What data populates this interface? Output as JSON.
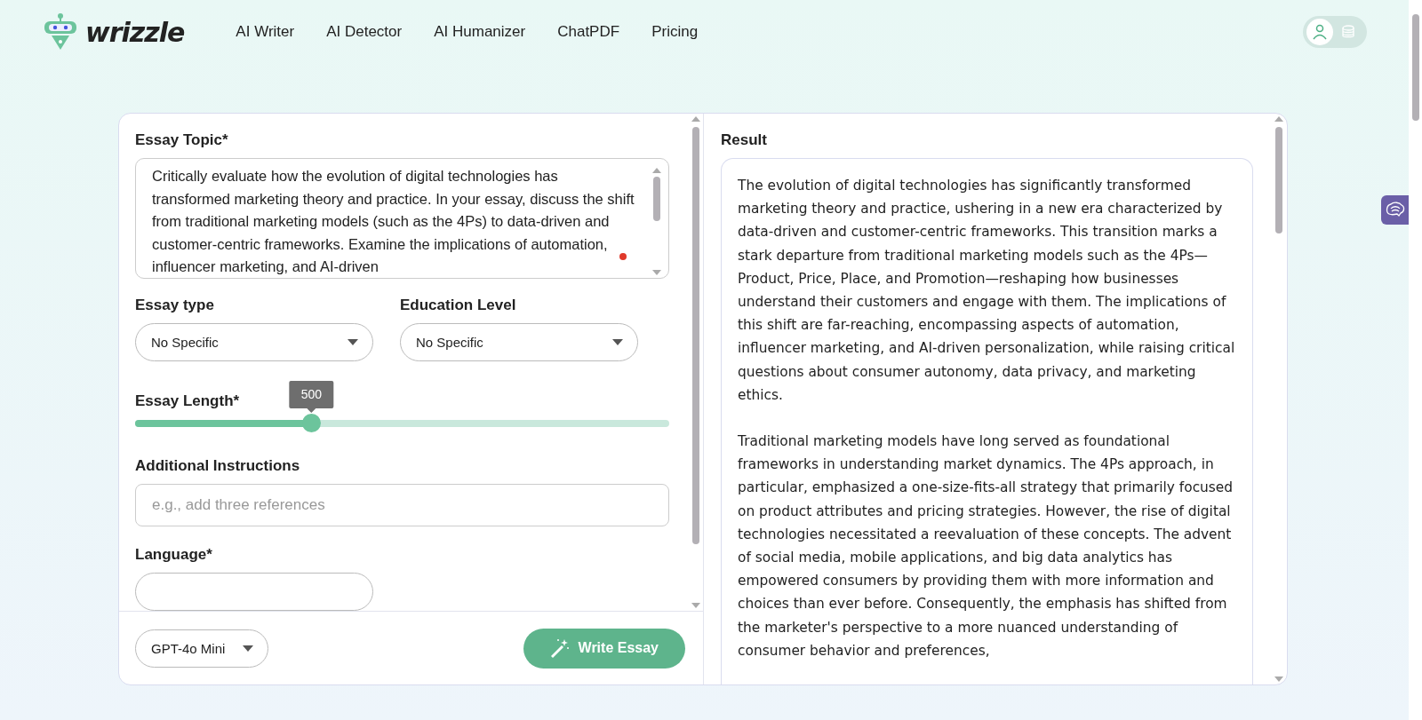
{
  "header": {
    "logo": "wrizzle",
    "nav": [
      "AI Writer",
      "AI Detector",
      "AI Humanizer",
      "ChatPDF",
      "Pricing"
    ],
    "account_toggle": [
      {
        "kind": "user",
        "selected": true
      },
      {
        "kind": "coins",
        "selected": false
      }
    ]
  },
  "form": {
    "topic": {
      "label": "Essay Topic*",
      "value": "Critically evaluate how the evolution of digital technologies has transformed marketing theory and practice. In your essay, discuss the shift from traditional marketing models (such as the 4Ps) to data-driven and customer-centric frameworks. Examine the implications of automation, influencer marketing, and AI-driven"
    },
    "essay_type": {
      "label": "Essay type",
      "value": "No Specific"
    },
    "education_level": {
      "label": "Education Level",
      "value": "No Specific"
    },
    "length": {
      "label": "Essay Length*",
      "value": "500",
      "level": 0.33
    },
    "instructions": {
      "label": "Additional Instructions",
      "placeholder": "e.g., add three references"
    },
    "language": {
      "label": "Language*"
    },
    "model": "GPT-4o Mini",
    "submit": "Write Essay"
  },
  "result": {
    "label": "Result",
    "paragraphs": [
      "The evolution of digital technologies has significantly transformed marketing theory and practice, ushering in a new era characterized by data-driven and customer-centric frameworks. This transition marks a stark departure from traditional marketing models such as the 4Ps—Product, Price, Place, and Promotion—reshaping how businesses understand their customers and engage with them. The implications of this shift are far-reaching, encompassing aspects of automation, influencer marketing, and AI-driven personalization, while raising critical questions about consumer autonomy, data privacy, and marketing ethics.",
      "Traditional marketing models have long served as foundational frameworks in understanding market dynamics. The 4Ps approach, in particular, emphasized a one-size-fits-all strategy that primarily focused on product attributes and pricing strategies. However, the rise of digital technologies necessitated a reevaluation of these concepts. The advent of social media, mobile applications, and big data analytics has empowered consumers by providing them with more information and choices than ever before. Consequently, the emphasis has shifted from the marketer's perspective to a more nuanced understanding of consumer behavior and preferences,"
    ]
  }
}
